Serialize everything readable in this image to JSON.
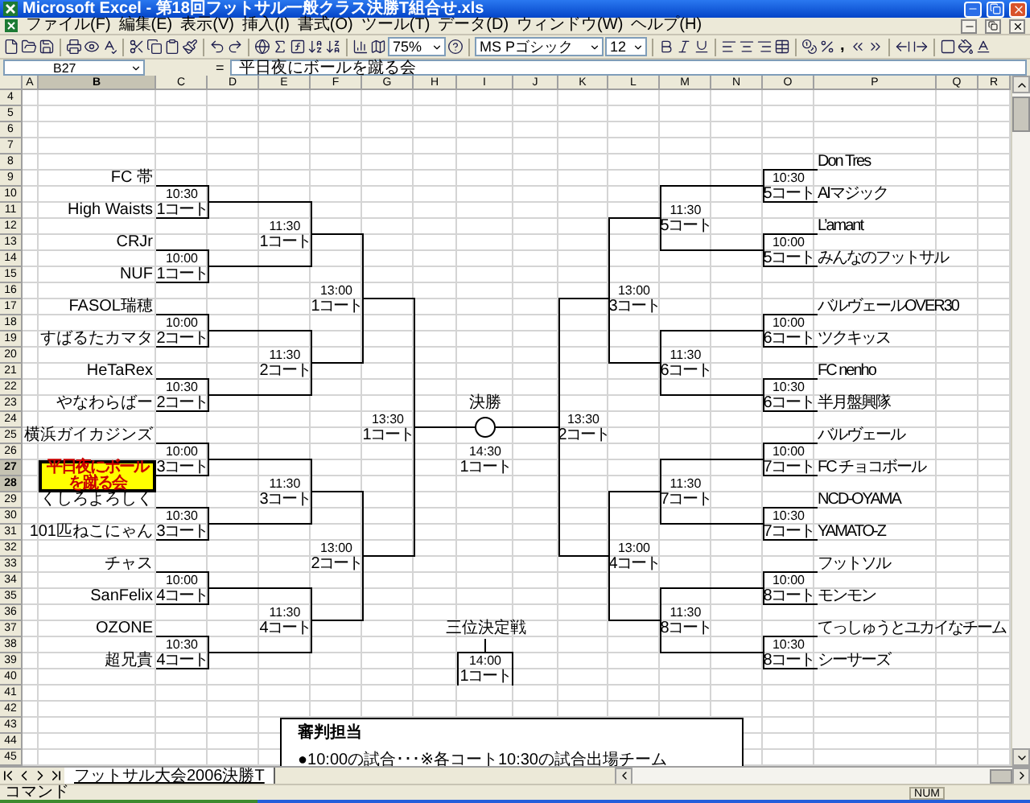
{
  "window": {
    "title": "Microsoft Excel - 第18回フットサル一般クラス決勝T組合せ.xls"
  },
  "menu": [
    "ファイル(F)",
    "編集(E)",
    "表示(V)",
    "挿入(I)",
    "書式(O)",
    "ツール(T)",
    "データ(D)",
    "ウィンドウ(W)",
    "ヘルプ(H)"
  ],
  "toolbar": {
    "zoom": "75%",
    "font": "MS Pゴシック",
    "size": "12",
    "comma": ","
  },
  "formula_bar": {
    "name_box": "B27",
    "equals": "=",
    "value": "平日夜にボールを蹴る会"
  },
  "columns": [
    {
      "label": "A",
      "selected": false
    },
    {
      "label": "B",
      "selected": true
    },
    {
      "label": "C",
      "selected": false
    },
    {
      "label": "D",
      "selected": false
    },
    {
      "label": "E",
      "selected": false
    },
    {
      "label": "F",
      "selected": false
    },
    {
      "label": "G",
      "selected": false
    },
    {
      "label": "H",
      "selected": false
    },
    {
      "label": "I",
      "selected": false
    },
    {
      "label": "J",
      "selected": false
    },
    {
      "label": "K",
      "selected": false
    },
    {
      "label": "L",
      "selected": false
    },
    {
      "label": "M",
      "selected": false
    },
    {
      "label": "N",
      "selected": false
    },
    {
      "label": "O",
      "selected": false
    },
    {
      "label": "P",
      "selected": false
    },
    {
      "label": "Q",
      "selected": false
    },
    {
      "label": "R",
      "selected": false
    }
  ],
  "rows": [
    {
      "label": "4",
      "selected": false
    },
    {
      "label": "5",
      "selected": false
    },
    {
      "label": "6",
      "selected": false
    },
    {
      "label": "7",
      "selected": false
    },
    {
      "label": "8",
      "selected": false
    },
    {
      "label": "9",
      "selected": false
    },
    {
      "label": "10",
      "selected": false
    },
    {
      "label": "11",
      "selected": false
    },
    {
      "label": "12",
      "selected": false
    },
    {
      "label": "13",
      "selected": false
    },
    {
      "label": "14",
      "selected": false
    },
    {
      "label": "15",
      "selected": false
    },
    {
      "label": "16",
      "selected": false
    },
    {
      "label": "17",
      "selected": false
    },
    {
      "label": "18",
      "selected": false
    },
    {
      "label": "19",
      "selected": false
    },
    {
      "label": "20",
      "selected": false
    },
    {
      "label": "21",
      "selected": false
    },
    {
      "label": "22",
      "selected": false
    },
    {
      "label": "23",
      "selected": false
    },
    {
      "label": "24",
      "selected": false
    },
    {
      "label": "25",
      "selected": false
    },
    {
      "label": "26",
      "selected": false
    },
    {
      "label": "27",
      "selected": true
    },
    {
      "label": "28",
      "selected": true
    },
    {
      "label": "29",
      "selected": false
    },
    {
      "label": "30",
      "selected": false
    },
    {
      "label": "31",
      "selected": false
    },
    {
      "label": "32",
      "selected": false
    },
    {
      "label": "33",
      "selected": false
    },
    {
      "label": "34",
      "selected": false
    },
    {
      "label": "35",
      "selected": false
    },
    {
      "label": "36",
      "selected": false
    },
    {
      "label": "37",
      "selected": false
    },
    {
      "label": "38",
      "selected": false
    },
    {
      "label": "39",
      "selected": false
    },
    {
      "label": "40",
      "selected": false
    },
    {
      "label": "41",
      "selected": false
    },
    {
      "label": "42",
      "selected": false
    },
    {
      "label": "43",
      "selected": false
    },
    {
      "label": "44",
      "selected": false
    },
    {
      "label": "45",
      "selected": false
    }
  ],
  "bracket": {
    "left": {
      "teams": [
        {
          "name": "FC 帯",
          "highlighted": false,
          "selected": false
        },
        {
          "name": "High Waists",
          "highlighted": false,
          "selected": false
        },
        {
          "name": "CRJr",
          "highlighted": false,
          "selected": false
        },
        {
          "name": "NUF",
          "highlighted": false,
          "selected": false
        },
        {
          "name": "FASOL瑞穂",
          "highlighted": false,
          "selected": false
        },
        {
          "name": "すばるたカマタ",
          "highlighted": false,
          "selected": false
        },
        {
          "name": "HeTaRex",
          "highlighted": false,
          "selected": false
        },
        {
          "name": "やなわらばー",
          "highlighted": false,
          "selected": false
        },
        {
          "name": "横浜ガイカジンズ",
          "highlighted": false,
          "selected": false
        },
        {
          "name": "平日夜にボールを蹴る会",
          "highlighted": true,
          "selected": true
        },
        {
          "name": "くしろよろしく",
          "highlighted": false,
          "selected": false
        },
        {
          "name": "101匹ねこにゃん",
          "highlighted": false,
          "selected": false
        },
        {
          "name": "チャス",
          "highlighted": false,
          "selected": false
        },
        {
          "name": "SanFelix",
          "highlighted": false,
          "selected": false
        },
        {
          "name": "OZONE",
          "highlighted": false,
          "selected": false
        },
        {
          "name": "超兄貴",
          "highlighted": false,
          "selected": false
        }
      ],
      "rounds": [
        [
          {
            "time": "10:30",
            "court": "1コート"
          },
          {
            "time": "10:00",
            "court": "1コート"
          },
          {
            "time": "10:00",
            "court": "2コート"
          },
          {
            "time": "10:30",
            "court": "2コート"
          },
          {
            "time": "10:00",
            "court": "3コート"
          },
          {
            "time": "10:30",
            "court": "3コート"
          },
          {
            "time": "10:00",
            "court": "4コート"
          },
          {
            "time": "10:30",
            "court": "4コート"
          }
        ],
        [
          {
            "time": "11:30",
            "court": "1コート"
          },
          {
            "time": "11:30",
            "court": "2コート"
          },
          {
            "time": "11:30",
            "court": "3コート"
          },
          {
            "time": "11:30",
            "court": "4コート"
          }
        ],
        [
          {
            "time": "13:00",
            "court": "1コート"
          },
          {
            "time": "13:00",
            "court": "2コート"
          }
        ],
        [
          {
            "time": "13:30",
            "court": "1コート"
          }
        ]
      ]
    },
    "right": {
      "teams": [
        {
          "name": "Don Tres",
          "highlighted": false,
          "selected": false
        },
        {
          "name": "AIマジック",
          "highlighted": false,
          "selected": false
        },
        {
          "name": "L’amant",
          "highlighted": false,
          "selected": false
        },
        {
          "name": "みんなのフットサル",
          "highlighted": false,
          "selected": false
        },
        {
          "name": "バルヴェールOVER30",
          "highlighted": false,
          "selected": false
        },
        {
          "name": "ツクキッス",
          "highlighted": false,
          "selected": false
        },
        {
          "name": "FC nenho",
          "highlighted": false,
          "selected": false
        },
        {
          "name": "半月盤興隊",
          "highlighted": false,
          "selected": false
        },
        {
          "name": "バルヴェール",
          "highlighted": false,
          "selected": false
        },
        {
          "name": "FC チョコボール",
          "highlighted": false,
          "selected": false
        },
        {
          "name": "NCD-OYAMA",
          "highlighted": false,
          "selected": false
        },
        {
          "name": "YAMATO-Z",
          "highlighted": false,
          "selected": false
        },
        {
          "name": "フットソル",
          "highlighted": false,
          "selected": false
        },
        {
          "name": "モンモン",
          "highlighted": false,
          "selected": false
        },
        {
          "name": "てっしゅうとユカイなチーム",
          "highlighted": false,
          "selected": false
        },
        {
          "name": "シーサーズ",
          "highlighted": false,
          "selected": false
        }
      ],
      "rounds": [
        [
          {
            "time": "13:30",
            "court": "2コート"
          }
        ],
        [
          {
            "time": "13:00",
            "court": "3コート"
          },
          {
            "time": "13:00",
            "court": "4コート"
          }
        ],
        [
          {
            "time": "11:30",
            "court": "5コート"
          },
          {
            "time": "11:30",
            "court": "6コート"
          },
          {
            "time": "11:30",
            "court": "7コート"
          },
          {
            "time": "11:30",
            "court": "8コート"
          }
        ],
        [
          {
            "time": "10:30",
            "court": "5コート"
          },
          {
            "time": "10:00",
            "court": "5コート"
          },
          {
            "time": "10:00",
            "court": "6コート"
          },
          {
            "time": "10:30",
            "court": "6コート"
          },
          {
            "time": "10:00",
            "court": "7コート"
          },
          {
            "time": "10:30",
            "court": "7コート"
          },
          {
            "time": "10:00",
            "court": "8コート"
          },
          {
            "time": "10:30",
            "court": "8コート"
          }
        ]
      ]
    },
    "final": {
      "title": "決勝",
      "time": "14:30",
      "court": "1コート"
    },
    "third_place": {
      "title": "三位決定戦",
      "time": "14:00",
      "court": "1コート"
    }
  },
  "note": {
    "title": "審判担当",
    "text": "●10:00の試合･･･※各コート10:30の試合出場チーム"
  },
  "sheet_tabs": [
    {
      "label": "フットサル大会2006決勝T",
      "selected": true
    }
  ],
  "status_bar": {
    "mode": "コマンド",
    "indicator": "NUM"
  }
}
